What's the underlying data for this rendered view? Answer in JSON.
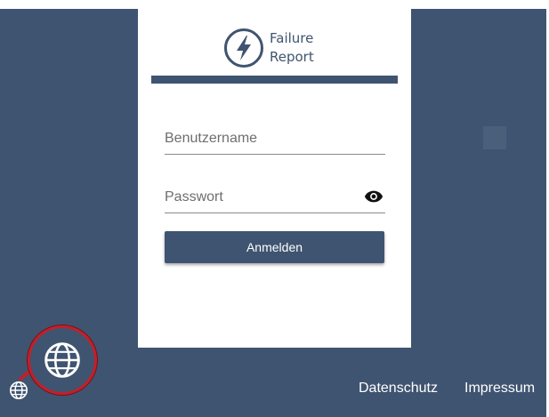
{
  "app": {
    "logo_line1": "Failure",
    "logo_line2": "Report"
  },
  "login": {
    "username_placeholder": "Benutzername",
    "password_placeholder": "Passwort",
    "submit_label": "Anmelden",
    "password_visibility_icon": "eye-icon"
  },
  "footer": {
    "privacy_label": "Datenschutz",
    "imprint_label": "Impressum",
    "language_icon": "globe-icon"
  },
  "colors": {
    "primary": "#3f5470",
    "card": "#ffffff",
    "highlight_ring": "#c2202a"
  }
}
